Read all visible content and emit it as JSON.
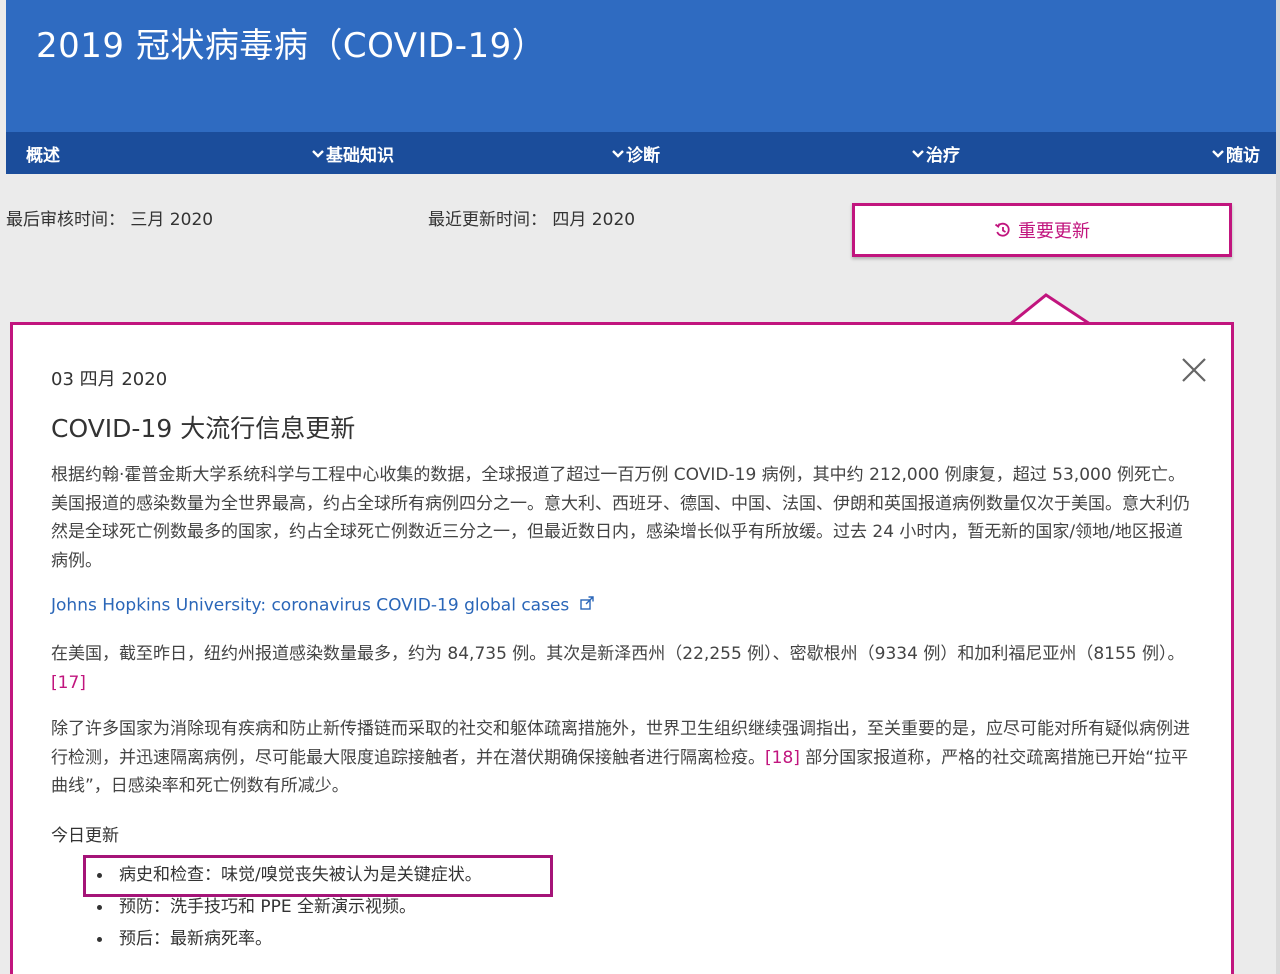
{
  "header": {
    "title": "2019 冠状病毒病（COVID-19）"
  },
  "nav": [
    {
      "label": "概述"
    },
    {
      "label": "基础知识"
    },
    {
      "label": "诊断"
    },
    {
      "label": "治疗"
    },
    {
      "label": "随访"
    }
  ],
  "meta": {
    "reviewed": "最后审核时间： 三月 2020",
    "updated": "最近更新时间： 四月 2020"
  },
  "key_update_button": {
    "label": "重要更新",
    "icon": "history-icon"
  },
  "update": {
    "date": "03 四月 2020",
    "title": "COVID-19 大流行信息更新",
    "para1": "根据约翰·霍普金斯大学系统科学与工程中心收集的数据，全球报道了超过一百万例 COVID-19 病例，其中约 212,000 例康复，超过 53,000 例死亡。美国报道的感染数量为全世界最高，约占全球所有病例四分之一。意大利、西班牙、德国、中国、法国、伊朗和英国报道病例数量仅次于美国。意大利仍然是全球死亡例数最多的国家，约占全球死亡例数近三分之一，但最近数日内，感染增长似乎有所放缓。过去 24 小时内，暂无新的国家/领地/地区报道病例。",
    "link": "Johns Hopkins University: coronavirus COVID-19 global cases",
    "para2": "在美国，截至昨日，纽约州报道感染数量最多，约为 84,735 例。其次是新泽西州（22,255 例）、密歇根州（9334 例）和加利福尼亚州（8155 例）。",
    "ref17": "[17]",
    "para3a": "除了许多国家为消除现有疾病和防止新传播链而采取的社交和躯体疏离措施外，世界卫生组织继续强调指出，至关重要的是，应尽可能对所有疑似病例进行检测，并迅速隔离病例，尽可能最大限度追踪接触者，并在潜伏期确保接触者进行隔离检疫。",
    "ref18": "[18]",
    "para3b": " 部分国家报道称，严格的社交疏离措施已开始“拉平曲线”，日感染率和死亡例数有所减少。",
    "today_label": "今日更新",
    "bullets": [
      "病史和检查：味觉/嗅觉丧失被认为是关键症状。",
      "预防：洗手技巧和 PPE 全新演示视频。",
      "预后：最新病死率。"
    ]
  },
  "colors": {
    "header": "#2f6bc1",
    "nav": "#1b4d9b",
    "accent": "#c1157e",
    "link": "#2a66b8"
  }
}
